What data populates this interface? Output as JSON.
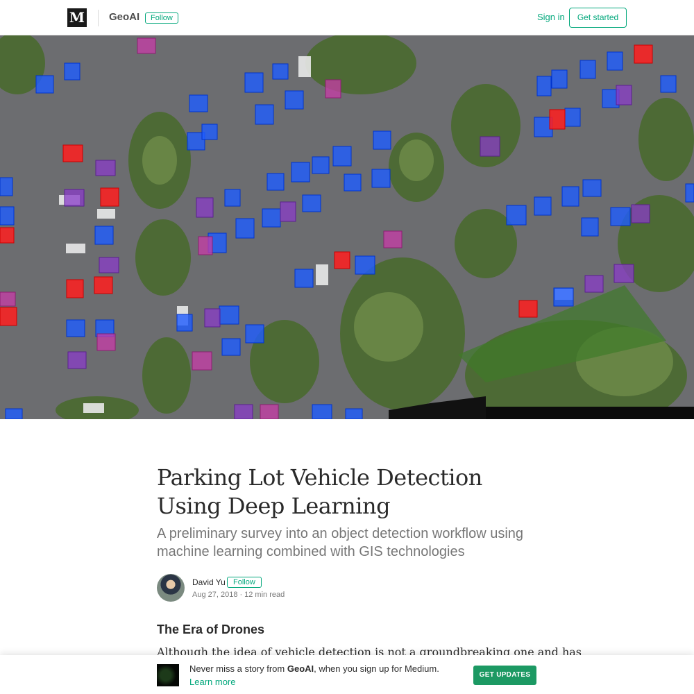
{
  "header": {
    "logo_letter": "M",
    "publication": "GeoAI",
    "follow_label": "Follow",
    "signin_label": "Sign in",
    "get_started_label": "Get started"
  },
  "hero": {
    "description": "aerial-parking-lot-photo-with-detection-boxes",
    "colors": {
      "blue": "#1f5cff",
      "red": "#ff1e1e",
      "purple": "#8a3cc8",
      "magenta": "#c83ca8"
    }
  },
  "article": {
    "title": "Parking Lot Vehicle Detection Using Deep Learning",
    "subtitle": "A preliminary survey into an object detection workflow using machine learning combined with GIS technologies",
    "author": "David Yu",
    "author_follow_label": "Follow",
    "date": "Aug 27, 2018",
    "read_time": "12 min read",
    "section_heading": "The Era of Drones",
    "first_line": "Although the idea of vehicle detection is not a groundbreaking one and has"
  },
  "banner": {
    "text_prefix": "Never miss a story from ",
    "publication": "GeoAI",
    "text_suffix": ", when you sign up for Medium.",
    "learn_more": "Learn more",
    "cta": "GET UPDATES"
  },
  "colors": {
    "accent": "#03a87c",
    "cta": "#1c9963"
  }
}
